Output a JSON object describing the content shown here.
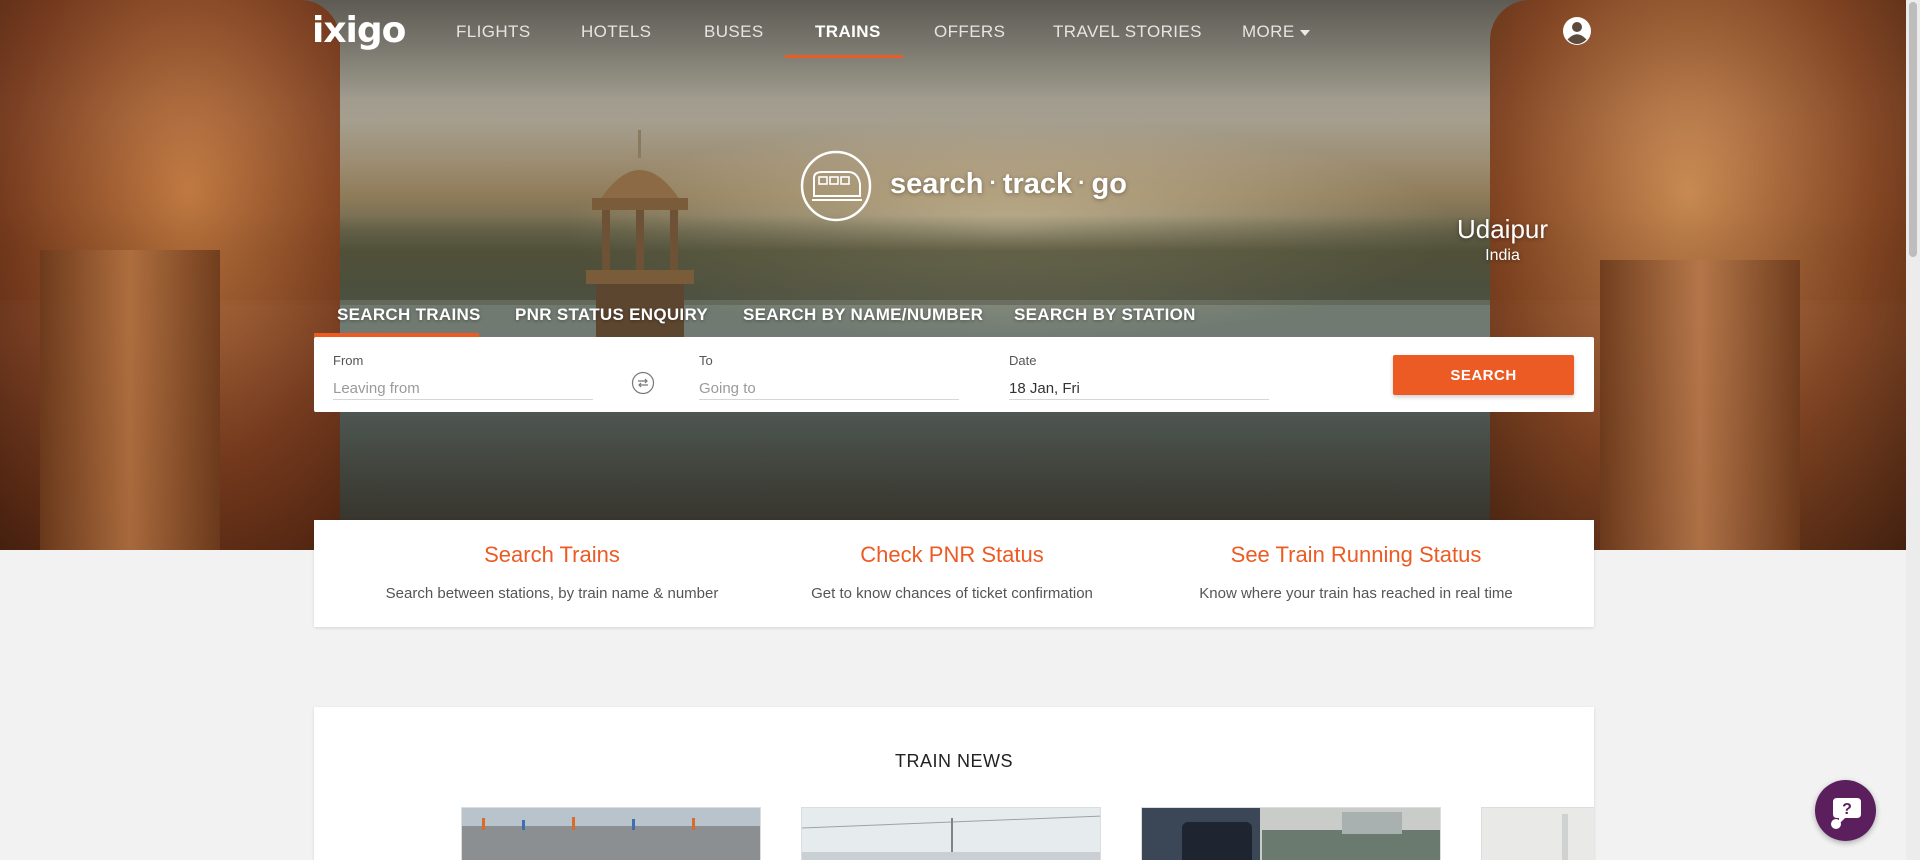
{
  "brand": {
    "logo_text": "ixigo"
  },
  "nav": {
    "items": [
      "FLIGHTS",
      "HOTELS",
      "BUSES",
      "TRAINS",
      "OFFERS",
      "TRAVEL STORIES",
      "MORE"
    ],
    "active": "TRAINS"
  },
  "hero": {
    "tagline": {
      "word1": "search",
      "word2": "track",
      "word3": "go",
      "separator": "·"
    },
    "place": {
      "city": "Udaipur",
      "country": "India"
    }
  },
  "search_tabs": [
    "SEARCH TRAINS",
    "PNR STATUS ENQUIRY",
    "SEARCH BY NAME/NUMBER",
    "SEARCH BY STATION"
  ],
  "search_form": {
    "from_label": "From",
    "from_placeholder": "Leaving from",
    "to_label": "To",
    "to_placeholder": "Going to",
    "date_label": "Date",
    "date_value": "18 Jan, Fri",
    "search_label": "SEARCH"
  },
  "features": [
    {
      "title": "Search Trains",
      "desc": "Search between stations, by train name & number"
    },
    {
      "title": "Check PNR Status",
      "desc": "Get to know chances of ticket confirmation"
    },
    {
      "title": "See Train Running Status",
      "desc": "Know where your train has reached in real time"
    }
  ],
  "news": {
    "title": "TRAIN NEWS"
  },
  "colors": {
    "accent": "#ec5b24",
    "chat": "#5a1f5c"
  },
  "icons": [
    "user-icon",
    "train-icon",
    "swap-icon",
    "chat-icon",
    "chevron-down-icon"
  ]
}
